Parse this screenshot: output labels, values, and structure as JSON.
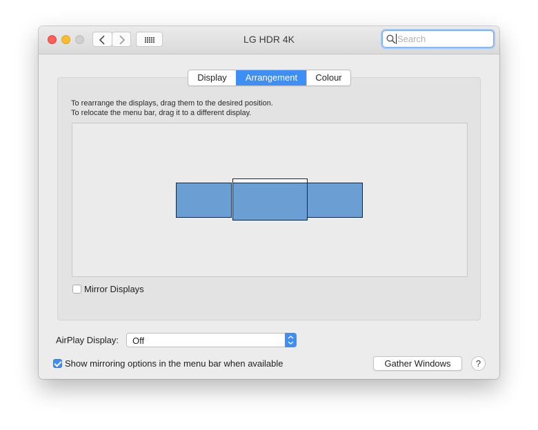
{
  "window": {
    "title": "LG HDR 4K",
    "search_placeholder": "Search"
  },
  "toolbar": {
    "back_icon": "chevron-left-icon",
    "forward_icon": "chevron-right-icon",
    "show_all_icon": "grid-icon"
  },
  "tabs": [
    {
      "label": "Display",
      "active": false
    },
    {
      "label": "Arrangement",
      "active": true
    },
    {
      "label": "Colour",
      "active": false
    }
  ],
  "instructions": {
    "line1": "To rearrange the displays, drag them to the desired position.",
    "line2": "To relocate the menu bar, drag it to a different display."
  },
  "displays": [
    {
      "name": "left-display",
      "has_menu_bar": false
    },
    {
      "name": "main-display",
      "has_menu_bar": true
    },
    {
      "name": "right-display",
      "has_menu_bar": false
    }
  ],
  "mirror": {
    "label": "Mirror Displays",
    "checked": false
  },
  "airplay": {
    "label": "AirPlay Display:",
    "value": "Off"
  },
  "mirroring_menu": {
    "label": "Show mirroring options in the menu bar when available",
    "checked": true
  },
  "gather_button": {
    "label": "Gather Windows"
  },
  "help": {
    "label": "?"
  },
  "colors": {
    "accent": "#3d8ef5",
    "display_fill": "#6b9fd3"
  }
}
